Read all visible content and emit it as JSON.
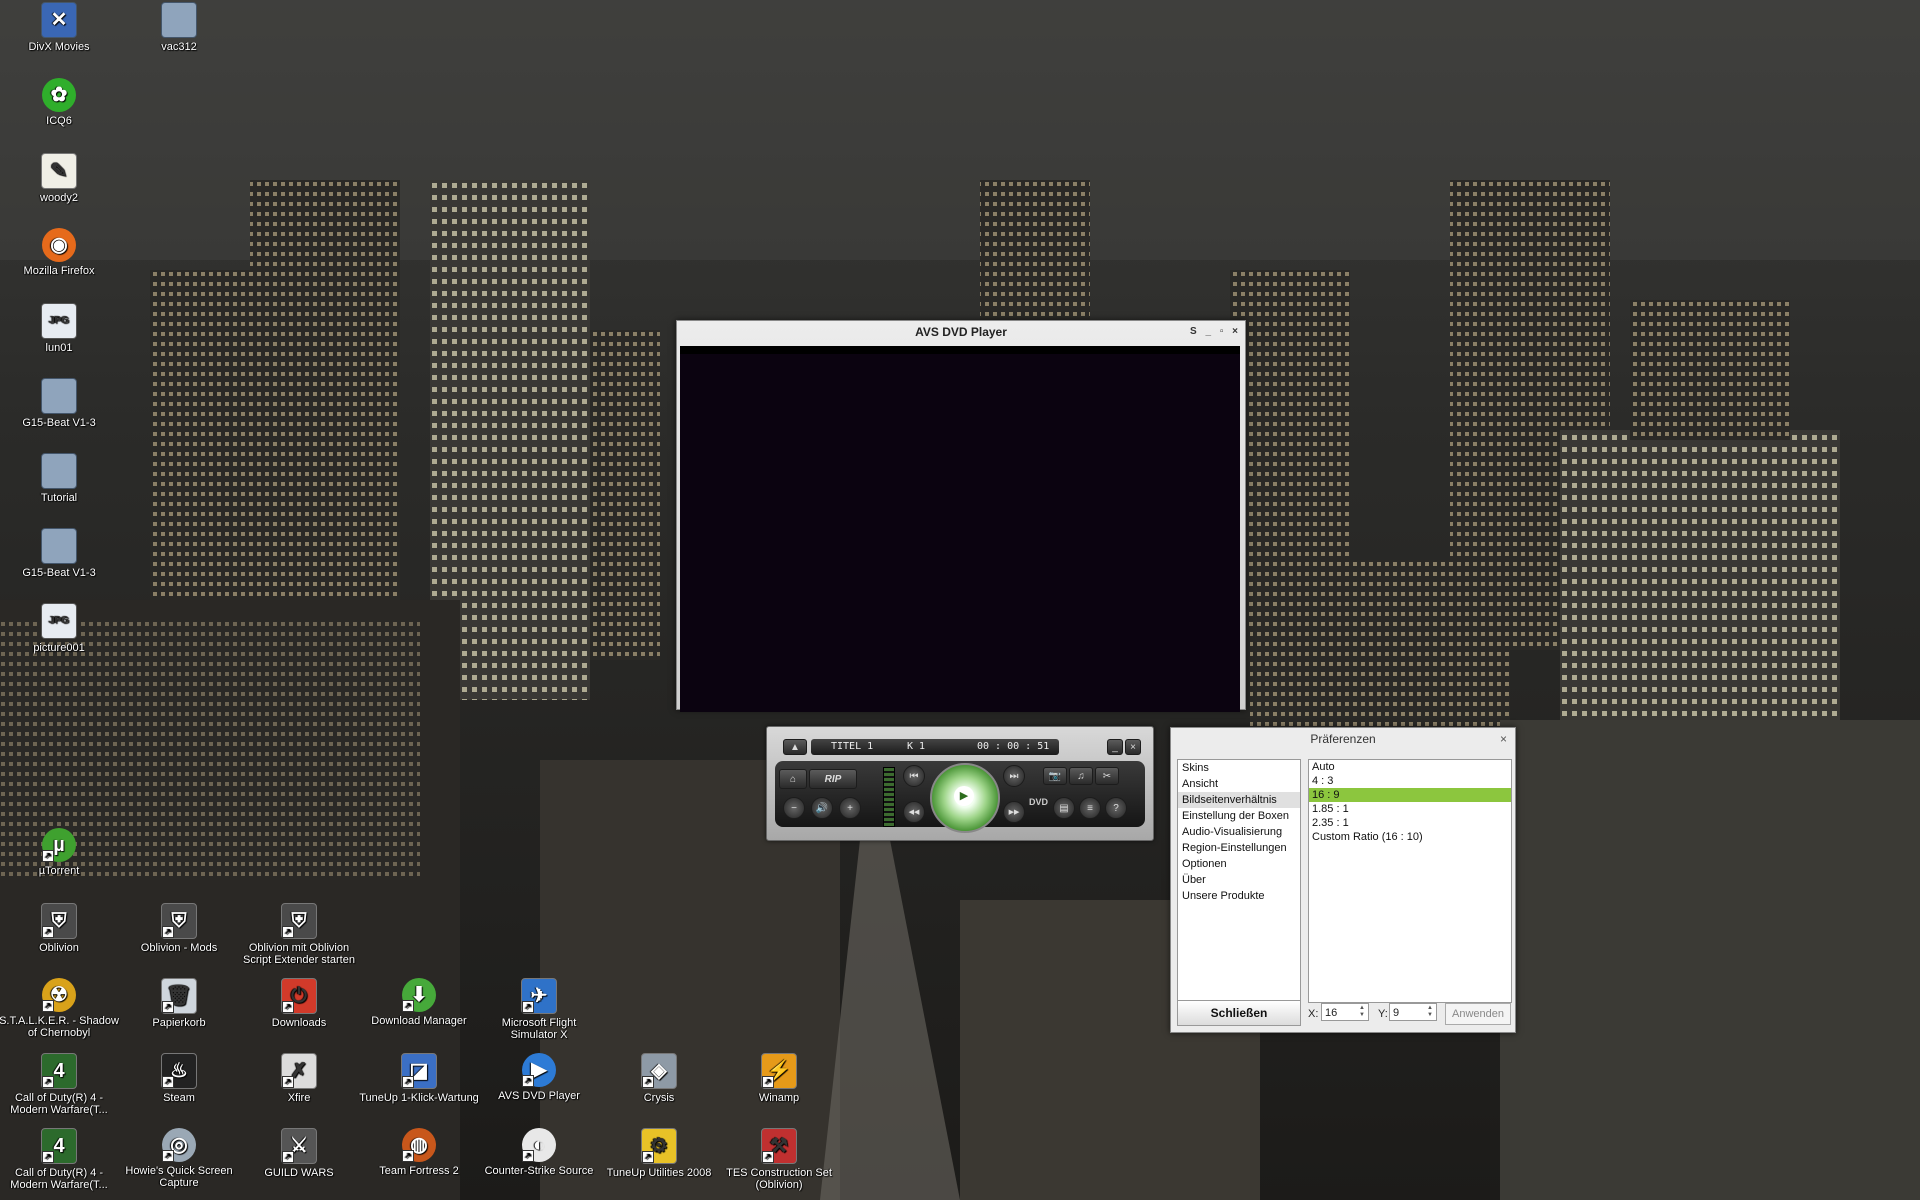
{
  "desktop_icons": [
    {
      "label": "DivX Movies",
      "icon": "shortcut-icon",
      "glyph": "✕",
      "style": "folder",
      "color": "#3a67b5"
    },
    {
      "label": "vac312",
      "icon": "folder-icon",
      "glyph": "",
      "style": "folder",
      "color": "#8fa4bc"
    },
    {
      "label": "ICQ6",
      "icon": "icq-flower-icon",
      "glyph": "✿",
      "style": "round",
      "color": "#2fae2b"
    },
    {
      "label": "woody2",
      "icon": "file-icon",
      "glyph": "✎",
      "style": "file",
      "color": "#f0efe6"
    },
    {
      "label": "Mozilla Firefox",
      "icon": "firefox-icon",
      "glyph": "◉",
      "style": "round",
      "color": "#e66a1b"
    },
    {
      "label": "lun01",
      "icon": "jpg-file-icon",
      "glyph": "JPG",
      "style": "jpg",
      "color": "#e7ecf2"
    },
    {
      "label": "G15-Beat V1-3",
      "icon": "folder-icon",
      "glyph": "",
      "style": "folder",
      "color": "#8fa4bc"
    },
    {
      "label": "Tutorial",
      "icon": "folder-icon",
      "glyph": "",
      "style": "folder",
      "color": "#8fa4bc"
    },
    {
      "label": "G15-Beat V1-3",
      "icon": "folder-icon",
      "glyph": "",
      "style": "folder",
      "color": "#8fa4bc"
    },
    {
      "label": "picture001",
      "icon": "jpg-file-icon",
      "glyph": "JPG",
      "style": "jpg",
      "color": "#e7ecf2"
    },
    {
      "label": "µTorrent",
      "icon": "utorrent-icon",
      "glyph": "µ",
      "style": "round",
      "color": "#3fa12f"
    },
    {
      "label": "Oblivion",
      "icon": "oblivion-icon",
      "glyph": "⛨",
      "style": "file",
      "color": "#4a4a4a"
    },
    {
      "label": "Oblivion - Mods",
      "icon": "oblivion-mods-icon",
      "glyph": "⛨",
      "style": "file",
      "color": "#4a4a4a"
    },
    {
      "label": "Oblivion mit Oblivion Script Extender starten",
      "icon": "oblivion-script-icon",
      "glyph": "⛨",
      "style": "file",
      "color": "#4a4a4a"
    },
    {
      "label": "S.T.A.L.K.E.R. - Shadow of Chernobyl",
      "icon": "radiation-icon",
      "glyph": "☢",
      "style": "round",
      "color": "#d9a21a"
    },
    {
      "label": "Papierkorb",
      "icon": "recycle-bin-icon",
      "glyph": "🗑",
      "style": "file",
      "color": "#cfd6dd"
    },
    {
      "label": "Downloads",
      "icon": "power-icon",
      "glyph": "⏻",
      "style": "file",
      "color": "#d23a2a"
    },
    {
      "label": "Download Manager",
      "icon": "download-manager-icon",
      "glyph": "⬇",
      "style": "round",
      "color": "#46a93a"
    },
    {
      "label": "Microsoft Flight Simulator X",
      "icon": "airplane-icon",
      "glyph": "✈",
      "style": "file",
      "color": "#2f72c8"
    },
    {
      "label": "Call of Duty(R) 4 - Modern Warfare(T...",
      "icon": "cod4-icon",
      "glyph": "4",
      "style": "file",
      "color": "#2c6a2c"
    },
    {
      "label": "Steam",
      "icon": "steam-icon",
      "glyph": "♨",
      "style": "file",
      "color": "#222222"
    },
    {
      "label": "Xfire",
      "icon": "xfire-icon",
      "glyph": "✗",
      "style": "file",
      "color": "#dcdcdc"
    },
    {
      "label": "TuneUp 1-Klick-Wartung",
      "icon": "tuneup-icon",
      "glyph": "◪",
      "style": "file",
      "color": "#3b6fc4"
    },
    {
      "label": "AVS DVD Player",
      "icon": "avs-dvd-icon",
      "glyph": "▶",
      "style": "round",
      "color": "#2d7bd6"
    },
    {
      "label": "Crysis",
      "icon": "crysis-icon",
      "glyph": "◈",
      "style": "file",
      "color": "#8e9aa6"
    },
    {
      "label": "Winamp",
      "icon": "winamp-icon",
      "glyph": "⚡",
      "style": "file",
      "color": "#e69a19"
    },
    {
      "label": "Call of Duty(R) 4 - Modern Warfare(T...",
      "icon": "cod4-icon",
      "glyph": "4",
      "style": "file",
      "color": "#2c6a2c"
    },
    {
      "label": "Howie's Quick Screen Capture",
      "icon": "screen-capture-icon",
      "glyph": "◎",
      "style": "round",
      "color": "#9aa8b5"
    },
    {
      "label": "GUILD WARS",
      "icon": "guild-wars-icon",
      "glyph": "⚔",
      "style": "file",
      "color": "#555555"
    },
    {
      "label": "Team Fortress 2",
      "icon": "tf2-icon",
      "glyph": "◍",
      "style": "round",
      "color": "#c8571b"
    },
    {
      "label": "Counter-Strike Source",
      "icon": "counter-strike-icon",
      "glyph": "◐",
      "style": "round",
      "color": "#e8e8e8"
    },
    {
      "label": "TuneUp Utilities 2008",
      "icon": "tuneup-utilities-icon",
      "glyph": "⚙",
      "style": "file",
      "color": "#e8c227"
    },
    {
      "label": "TES Construction Set (Oblivion)",
      "icon": "construction-set-icon",
      "glyph": "⚒",
      "style": "file",
      "color": "#c03030"
    }
  ],
  "video_window": {
    "title": "AVS DVD Player",
    "controls": "S _ ▫ ×"
  },
  "control_bar": {
    "eject": "▲",
    "title": "TITEL 1",
    "chapter": "K 1",
    "time": "00 : 00 : 51",
    "rip": "RIP",
    "home": "⌂",
    "minimize": "_",
    "close": "×",
    "prev": "⏮",
    "next": "⏭",
    "play": "▶",
    "rewind": "◀◀",
    "forward": "▶▶",
    "vol_down": "−",
    "mute": "🔊",
    "vol_up": "+",
    "dvd_logo": "DVD",
    "help": "?",
    "snapshot": "📷",
    "settings": "✂",
    "subtitle": "≡",
    "menu": "▤",
    "audio": "♫"
  },
  "preferences": {
    "title": "Präferenzen",
    "close": "×",
    "categories": [
      "Skins",
      "Ansicht",
      "Bildseitenverhältnis",
      "Einstellung der Boxen",
      "Audio-Visualisierung",
      "Region-Einstellungen",
      "Optionen",
      "Über",
      "Unsere Produkte"
    ],
    "selected_category": 2,
    "options": [
      "Auto",
      "4 : 3",
      "16 : 9",
      "1.85 : 1",
      "2.35 : 1",
      "Custom Ratio (16 : 10)"
    ],
    "selected_option": 2,
    "close_button": "Schließen",
    "x_label": "X:",
    "x_value": "16",
    "y_label": "Y:",
    "y_value": "9",
    "apply_button": "Anwenden"
  }
}
